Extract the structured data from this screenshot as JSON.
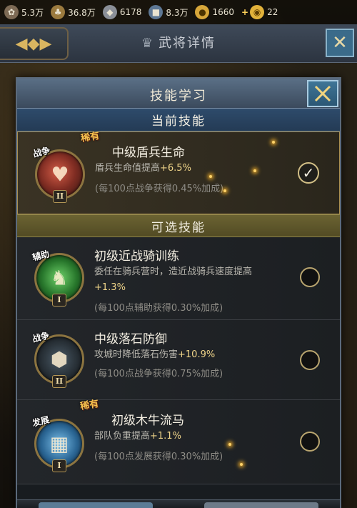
{
  "resources": [
    {
      "icon": "food-icon",
      "glyph": "✿",
      "value": "5.3万",
      "cls": "ri-food"
    },
    {
      "icon": "wood-icon",
      "glyph": "♣",
      "value": "36.8万",
      "cls": "ri-wood"
    },
    {
      "icon": "stone-icon",
      "glyph": "◆",
      "value": "6178",
      "cls": "ri-stone"
    },
    {
      "icon": "iron-icon",
      "glyph": "■",
      "value": "8.3万",
      "cls": "ri-iron"
    },
    {
      "icon": "copper-icon",
      "glyph": "●",
      "value": "1660",
      "cls": "ri-copper"
    },
    {
      "icon": "gold-icon",
      "glyph": "◉",
      "value": "22",
      "cls": "ri-gold"
    }
  ],
  "page_title": "武将详情",
  "dialog": {
    "title": "技能学习",
    "current_section": "当前技能",
    "optional_section": "可选技能"
  },
  "current_skill": {
    "type": "战争",
    "level": "II",
    "special": "稀有",
    "name": "中级盾兵生命",
    "desc_prefix": "盾兵生命值提高",
    "desc_value": "+6.5%",
    "note": "(每100点战争获得0.45%加成)",
    "selected": true
  },
  "skills": [
    {
      "type": "辅助",
      "level": "I",
      "name": "初级近战骑训练",
      "desc_prefix": "委任在骑兵营时，造近战骑兵速度提高",
      "desc_value": "+1.3%",
      "note": "(每100点辅助获得0.30%加成)"
    },
    {
      "type": "战争",
      "level": "II",
      "name": "中级落石防御",
      "desc_prefix": "攻城时降低落石伤害",
      "desc_value": "+10.9%",
      "note": "(每100点战争获得0.75%加成)"
    },
    {
      "type": "发展",
      "level": "I",
      "special": "稀有",
      "name": "初级木牛流马",
      "desc_prefix": "部队负重提高",
      "desc_value": "+1.1%",
      "note": "(每100点发展获得0.30%加成)"
    }
  ]
}
